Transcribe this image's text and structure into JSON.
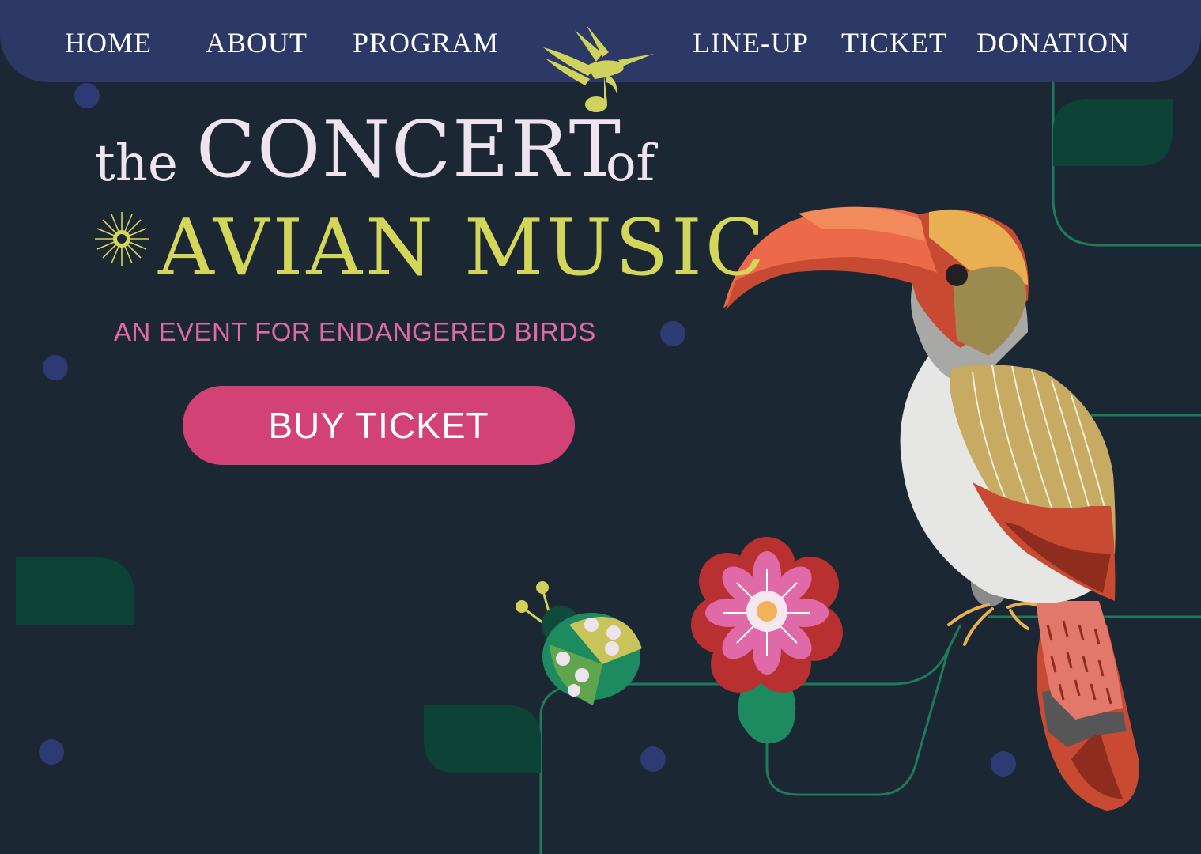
{
  "nav": {
    "home": "HOME",
    "about": "ABOUT",
    "program": "PROGRAM",
    "lineup": "LINE-UP",
    "ticket": "TICKET",
    "donation": "DONATION"
  },
  "hero": {
    "title_the": "the",
    "title_concert": "CONCERT",
    "title_of": "of",
    "title_avian_music": "AVIAN MUSIC",
    "subtitle": "AN EVENT FOR ENDANGERED BIRDS",
    "cta_label": "BUY TICKET"
  },
  "icons": {
    "logo": "hummingbird-music-note-icon",
    "sun": "sun-icon"
  },
  "colors": {
    "background": "#1c2734",
    "navbar": "#2c3866",
    "title_light": "#eee3ee",
    "title_accent": "#d4d65a",
    "subtitle": "#e06aa8",
    "cta": "#d24275",
    "dots": "#2e3a72",
    "leaf": "#0d4236"
  }
}
